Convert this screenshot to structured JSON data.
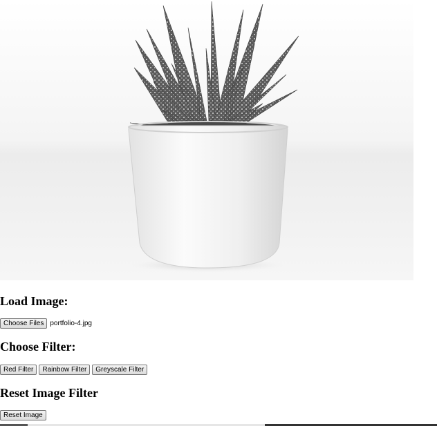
{
  "image": {
    "subject": "succulent-plant-in-white-pot"
  },
  "load": {
    "heading": "Load Image:",
    "choose_button": "Choose Files",
    "file_name": "portfolio-4.jpg"
  },
  "filter": {
    "heading": "Choose Filter:",
    "buttons": {
      "red": "Red Filter",
      "rainbow": "Rainbow Filter",
      "greyscale": "Greyscale Filter"
    }
  },
  "reset": {
    "heading": "Reset Image Filter",
    "button": "Reset Image"
  }
}
